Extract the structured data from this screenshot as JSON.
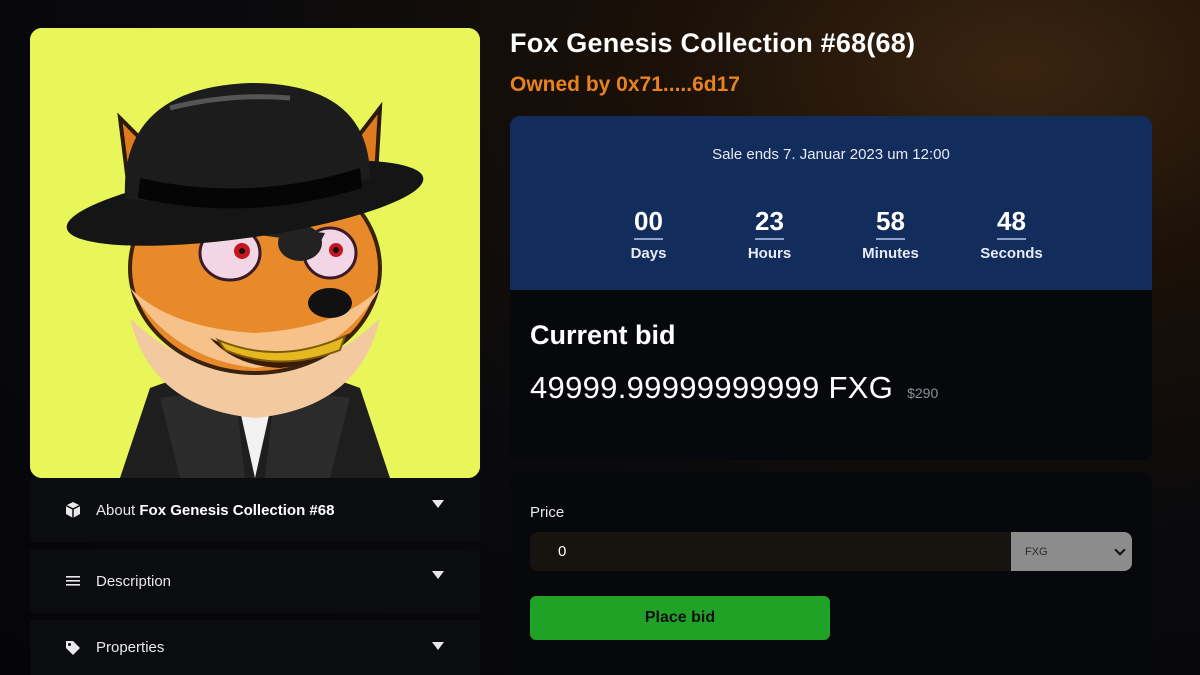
{
  "nft": {
    "title": "Fox Genesis Collection #68(68)",
    "owner_text": "Owned by 0x71.....6d17",
    "image_alt": "Fox wearing bowler hat and suit",
    "image_background": "#e8f65a"
  },
  "accordions": [
    {
      "icon": "cube-icon",
      "prefix": "About ",
      "bold": "Fox Genesis Collection #68"
    },
    {
      "icon": "list-icon",
      "prefix": "Description",
      "bold": ""
    },
    {
      "icon": "tag-icon",
      "prefix": "Properties",
      "bold": ""
    }
  ],
  "sale": {
    "ends_text": "Sale ends 7. Januar 2023 um 12:00",
    "countdown": [
      {
        "value": "00",
        "label": "Days"
      },
      {
        "value": "23",
        "label": "Hours"
      },
      {
        "value": "58",
        "label": "Minutes"
      },
      {
        "value": "48",
        "label": "Seconds"
      }
    ],
    "panel_color": "#122c5c"
  },
  "bid": {
    "heading": "Current bid",
    "amount": "49999.99999999999 FXG",
    "usd": "$290"
  },
  "form": {
    "price_label": "Price",
    "price_value": "0",
    "currency_selected": "FXG",
    "button_label": "Place bid",
    "button_color": "#1fa226"
  },
  "colors": {
    "owner_accent": "#e8821e"
  }
}
